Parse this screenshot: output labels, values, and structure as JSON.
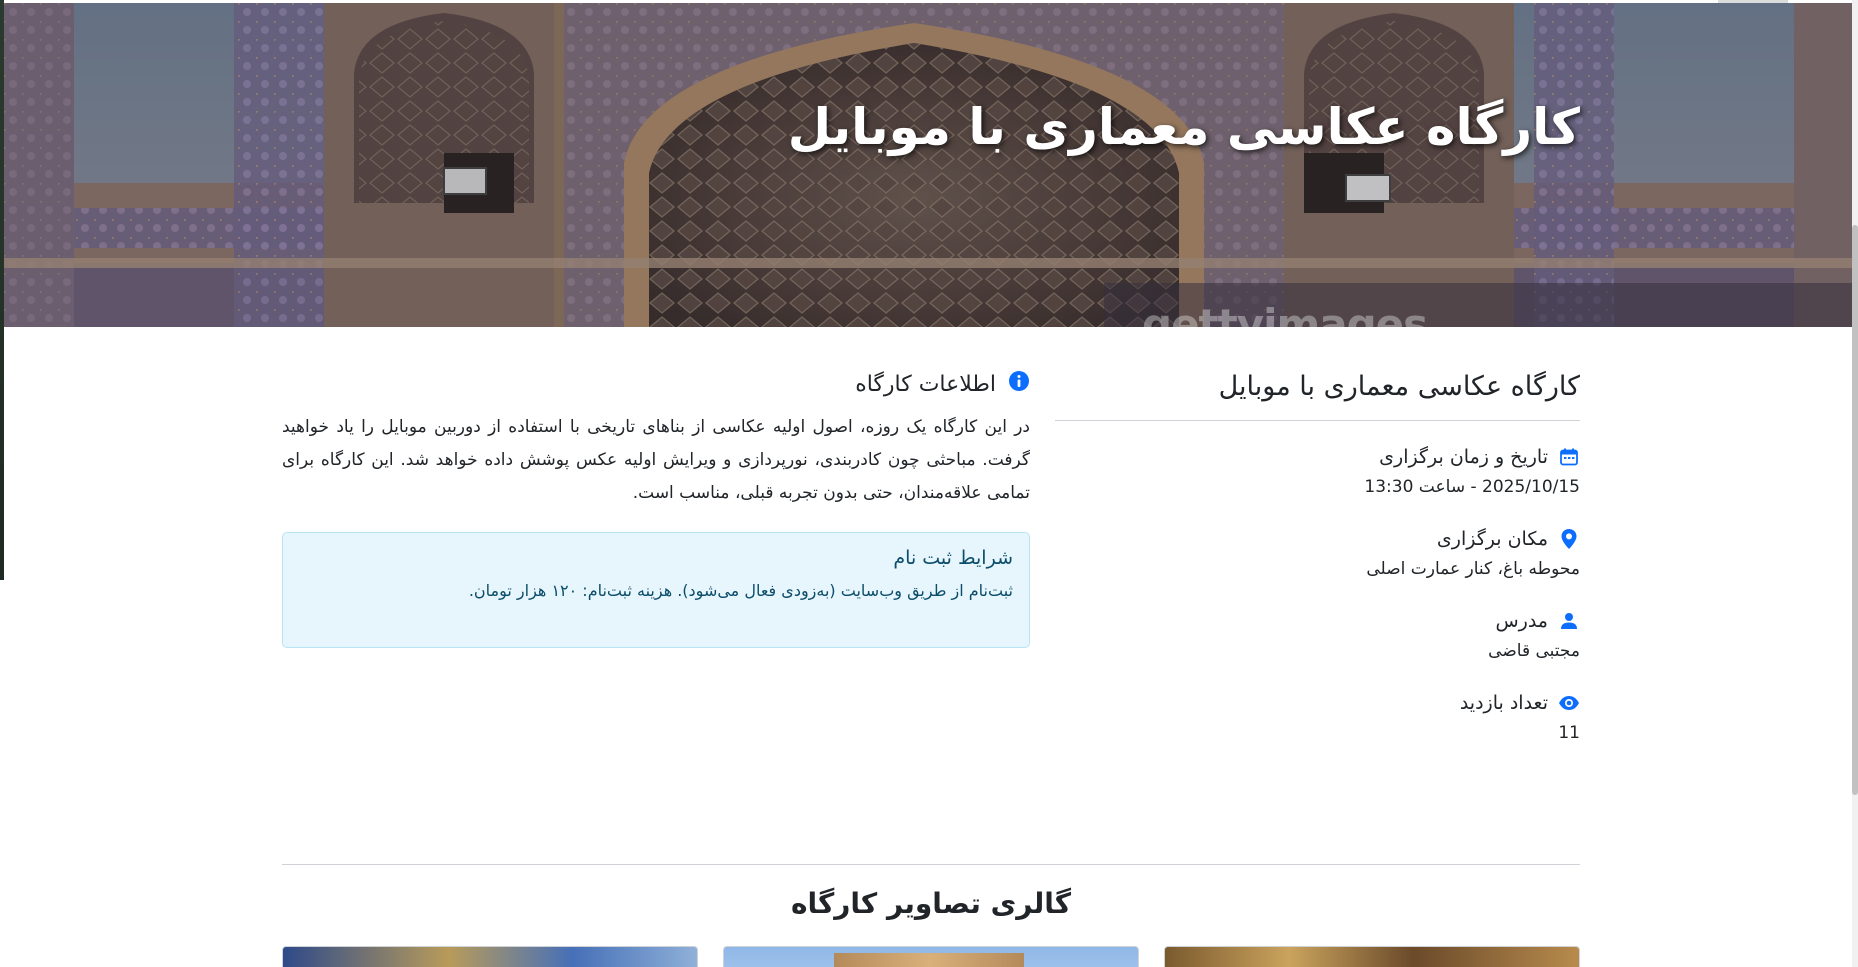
{
  "hero": {
    "title": "کارگاه عکاسی معماری با موبایل",
    "watermark": "gettyimages"
  },
  "event": {
    "title": "کارگاه عکاسی معماری با موبایل",
    "details": [
      {
        "icon": "calendar-icon",
        "label": "تاریخ و زمان برگزاری",
        "value": "2025/10/15 - ساعت 13:30"
      },
      {
        "icon": "location-pin-icon",
        "label": "مکان برگزاری",
        "value": "محوطه باغ، کنار عمارت اصلی"
      },
      {
        "icon": "person-icon",
        "label": "مدرس",
        "value": "مجتبی قاضی"
      },
      {
        "icon": "eye-icon",
        "label": "تعداد بازدید",
        "value": "11"
      }
    ]
  },
  "info": {
    "heading": "اطلاعات کارگاه",
    "icon": "info-circle-icon",
    "description": "در این کارگاه یک روزه، اصول اولیه عکاسی از بناهای تاریخی با استفاده از دوربین موبایل را یاد خواهید گرفت. مباحثی چون کادربندی، نورپردازی و ویرایش اولیه عکس پوشش داده خواهد شد. این کارگاه برای تمامی علاقه‌مندان، حتی بدون تجربه قبلی، مناسب است.",
    "registration": {
      "title": "شرایط ثبت نام",
      "text": "ثبت‌نام از طریق وب‌سایت (به‌زودی فعال می‌شود). هزینه ثبت‌نام: ۱۲۰ هزار تومان."
    }
  },
  "gallery": {
    "title": "گالری تصاویر کارگاه"
  },
  "colors": {
    "accent": "#0d6efd",
    "alert_bg": "#e7f6fc",
    "alert_text": "#0b4d6b"
  }
}
